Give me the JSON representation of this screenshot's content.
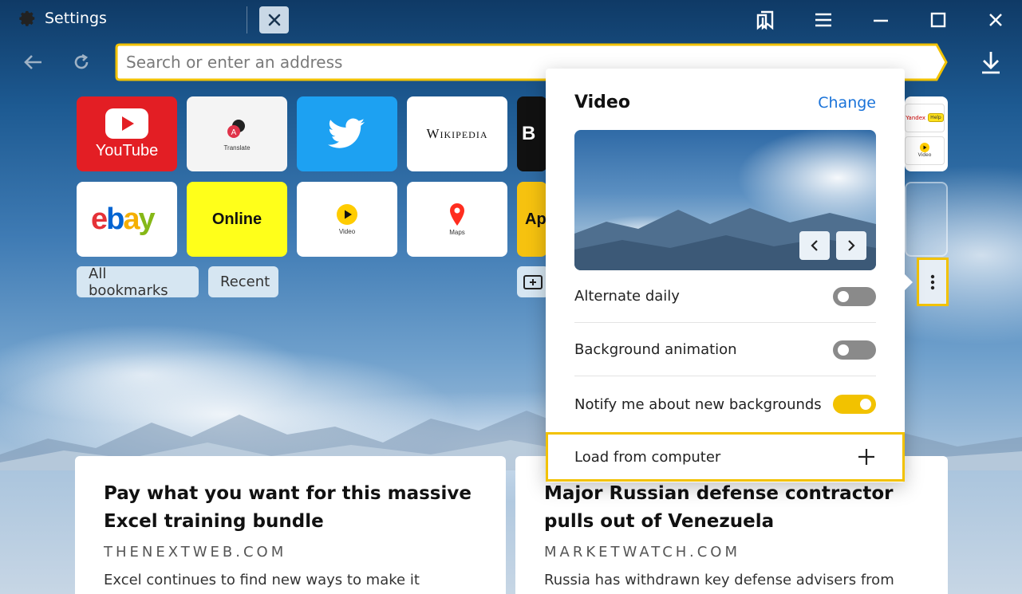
{
  "window": {
    "tab_title": "Settings",
    "icons": [
      "gear-icon",
      "close-icon",
      "bookmarks-icon",
      "menu-icon",
      "minimize-icon",
      "maximize-icon",
      "close-window-icon"
    ]
  },
  "toolbar": {
    "address_placeholder": "Search or enter an address",
    "accent_color": "#f2c200"
  },
  "tiles": {
    "youtube": "YouTube",
    "translate": "Translate",
    "wikipedia": "Wikipedia",
    "ebay": "ebay",
    "online": "Online",
    "video": "Video",
    "maps": "Maps",
    "apps_partial": "Ap",
    "dark_partial": "B",
    "group_yandex": "Yandex",
    "group_help": "Help",
    "group_video": "Video"
  },
  "buttons": {
    "all_bookmarks": "All bookmarks",
    "recent": "Recent"
  },
  "panel": {
    "title": "Video",
    "change": "Change",
    "settings": [
      {
        "label": "Alternate daily",
        "state": "off"
      },
      {
        "label": "Background animation",
        "state": "off"
      },
      {
        "label": "Notify me about new backgrounds",
        "state": "on"
      }
    ],
    "load_from_computer": "Load from computer"
  },
  "news": [
    {
      "title": "Pay what you want for this massive Excel training bundle",
      "source": "THENEXTWEB.COM",
      "snippet": "Excel continues to find new ways to make it"
    },
    {
      "title": "Major Russian defense contractor pulls out of Venezuela",
      "source": "MARKETWATCH.COM",
      "snippet": "Russia has withdrawn key defense advisers from"
    }
  ]
}
